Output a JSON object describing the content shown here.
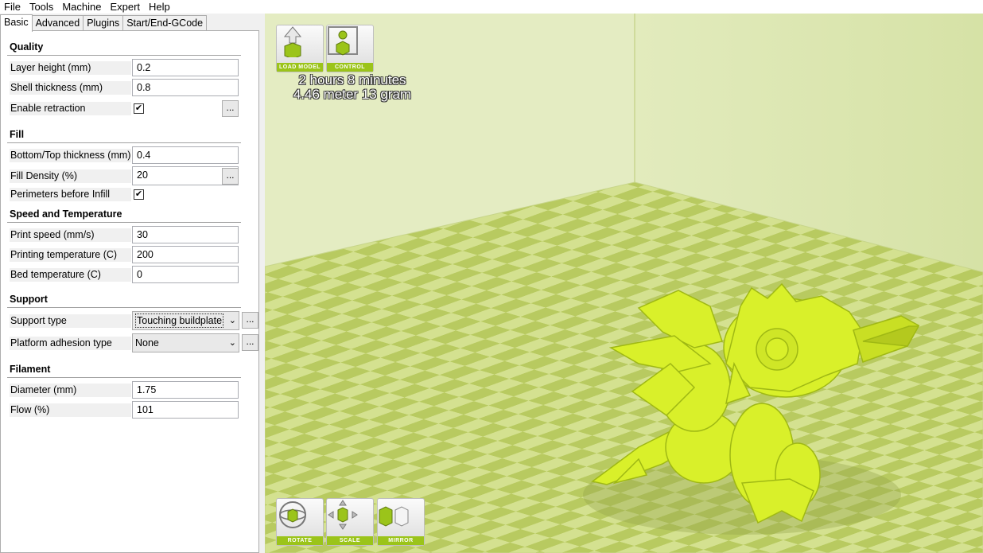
{
  "menu": [
    "File",
    "Tools",
    "Machine",
    "Expert",
    "Help"
  ],
  "tabs": [
    "Basic",
    "Advanced",
    "Plugins",
    "Start/End-GCode"
  ],
  "quality": {
    "title": "Quality",
    "layer_height_label": "Layer height (mm)",
    "layer_height": "0.2",
    "shell_thickness_label": "Shell thickness (mm)",
    "shell_thickness": "0.8",
    "retraction_label": "Enable retraction",
    "retraction_checked": true
  },
  "fill": {
    "title": "Fill",
    "bottom_top_label": "Bottom/Top thickness (mm)",
    "bottom_top": "0.4",
    "density_label": "Fill Density (%)",
    "density": "20",
    "perimeters_label": "Perimeters before Infill",
    "perimeters_checked": true
  },
  "speed": {
    "title": "Speed and Temperature",
    "print_speed_label": "Print speed (mm/s)",
    "print_speed": "30",
    "print_temp_label": "Printing temperature (C)",
    "print_temp": "200",
    "bed_temp_label": "Bed temperature (C)",
    "bed_temp": "0"
  },
  "support": {
    "title": "Support",
    "support_type_label": "Support type",
    "support_type": "Touching buildplate",
    "adhesion_label": "Platform adhesion type",
    "adhesion": "None"
  },
  "filament": {
    "title": "Filament",
    "diameter_label": "Diameter (mm)",
    "diameter": "1.75",
    "flow_label": "Flow (%)",
    "flow": "101"
  },
  "dots_label": "...",
  "check_mark": "✔",
  "viewport": {
    "buttons_top": [
      "LOAD MODEL",
      "CONTROL"
    ],
    "print_time": "2 hours 8 minutes",
    "print_usage": "4.46 meter 13 gram",
    "buttons_bottom": [
      "ROTATE",
      "SCALE",
      "MIRROR"
    ]
  },
  "colors": {
    "accent": "#9bc41a",
    "model": "#d9f02a",
    "floor_light": "#d4e190",
    "floor_dark": "#b7c95c",
    "walls": "#dbe6b0"
  }
}
